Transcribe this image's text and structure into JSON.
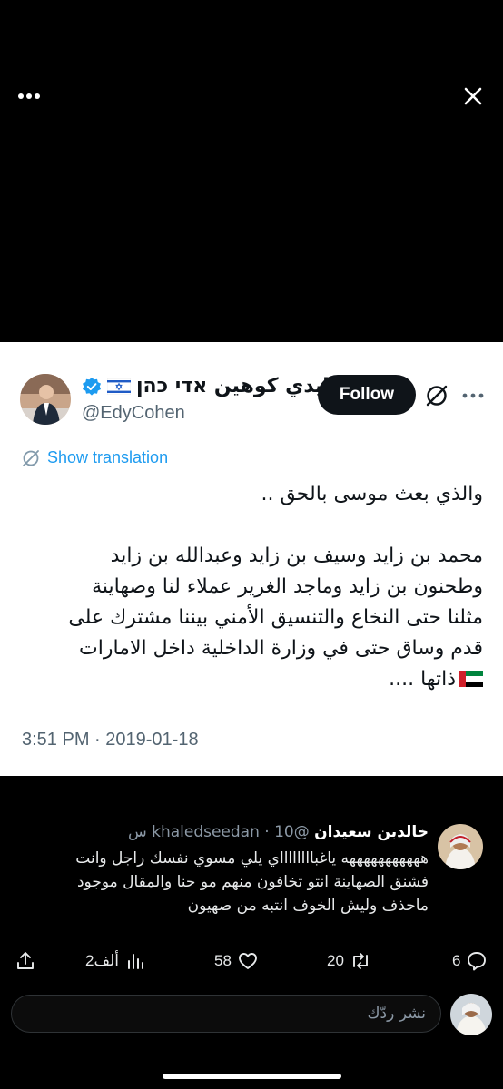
{
  "tweet": {
    "display_name": "إيدي كوهين אדי כהן",
    "handle": "@EdyCohen",
    "follow_label": "Follow",
    "show_translation": "Show translation",
    "body_lines": [
      "والذي بعث موسى بالحق ..",
      "محمد بن زايد وسيف بن زايد وعبدالله بن زايد",
      "وطحنون بن زايد وماجد الغرير عملاء لنا وصهاينة",
      "مثلنا حتى النخاع والتنسيق الأمني بيننا مشترك على",
      "قدم وساق حتى في وزارة الداخلية داخل الامارات",
      "ذاتها ...."
    ],
    "timestamp": "3:51 PM · 2019-01-18"
  },
  "reply": {
    "name": "خالدبن سعيدان",
    "handle": "@khaledseedan",
    "time": "10 س",
    "text_lines": [
      "هههههههههههه ياغبااااااااي يلي مسوي نفسك راجل وانت",
      "فشنق  الصهاينة انتو تخافون منهم مو حنا والمقال موجود",
      "ماحذف وليش الخوف انتبه من صهيون"
    ],
    "stats": {
      "replies": "6",
      "reposts": "20",
      "likes": "58",
      "views": "2ألف"
    }
  },
  "compose": {
    "placeholder": "نشر ردّك"
  },
  "colors": {
    "verified_blue": "#1d9bf0",
    "follow_bg": "#0f1419",
    "background": "#000000"
  },
  "icons": [
    "more-horizontal-icon",
    "close-icon",
    "verified-badge-icon",
    "israel-flag-icon",
    "x-logo-icon",
    "translate-icon",
    "uae-flag-icon",
    "reply-icon",
    "repost-icon",
    "like-icon",
    "views-icon",
    "share-icon"
  ]
}
